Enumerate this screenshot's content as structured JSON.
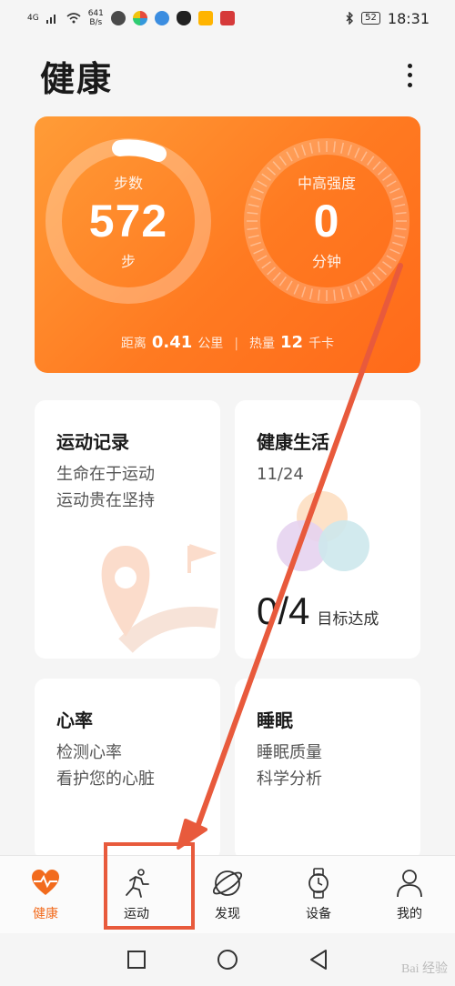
{
  "status_bar": {
    "signal": "4G",
    "net_speed_value": "641",
    "net_speed_unit": "B/s",
    "battery": "52",
    "time": "18:31"
  },
  "header": {
    "title": "健康",
    "more_icon": "more-vertical-icon"
  },
  "summary": {
    "steps": {
      "label": "步数",
      "value": "572",
      "unit": "步"
    },
    "intensity": {
      "label": "中高强度",
      "value": "0",
      "unit": "分钟"
    },
    "distance_label": "距离",
    "distance_value": "0.41",
    "distance_unit": "公里",
    "calorie_label": "热量",
    "calorie_value": "12",
    "calorie_unit": "千卡",
    "accent_start": "#ff9c37",
    "accent_end": "#ff6a1a"
  },
  "tiles": {
    "record": {
      "title": "运动记录",
      "line1": "生命在于运动",
      "line2": "运动贵在坚持"
    },
    "life": {
      "title": "健康生活",
      "date": "11/24",
      "goal_value": "0/4",
      "goal_label": "目标达成"
    },
    "heart": {
      "title": "心率",
      "line1": "检测心率",
      "line2": "看护您的心脏"
    },
    "sleep": {
      "title": "睡眠",
      "line1": "睡眠质量",
      "line2": "科学分析"
    }
  },
  "tabs": [
    {
      "label": "健康",
      "icon": "heart-pulse-icon",
      "active": true
    },
    {
      "label": "运动",
      "icon": "running-person-icon",
      "active": false
    },
    {
      "label": "发现",
      "icon": "planet-icon",
      "active": false
    },
    {
      "label": "设备",
      "icon": "watch-icon",
      "active": false
    },
    {
      "label": "我的",
      "icon": "person-icon",
      "active": false
    }
  ],
  "navbar": {
    "recent_icon": "square-icon",
    "home_icon": "circle-icon",
    "back_icon": "triangle-back-icon"
  },
  "watermark": "Bai 经验",
  "colors": {
    "active_tab": "#f26b1d",
    "annotation": "#e85a3c"
  }
}
